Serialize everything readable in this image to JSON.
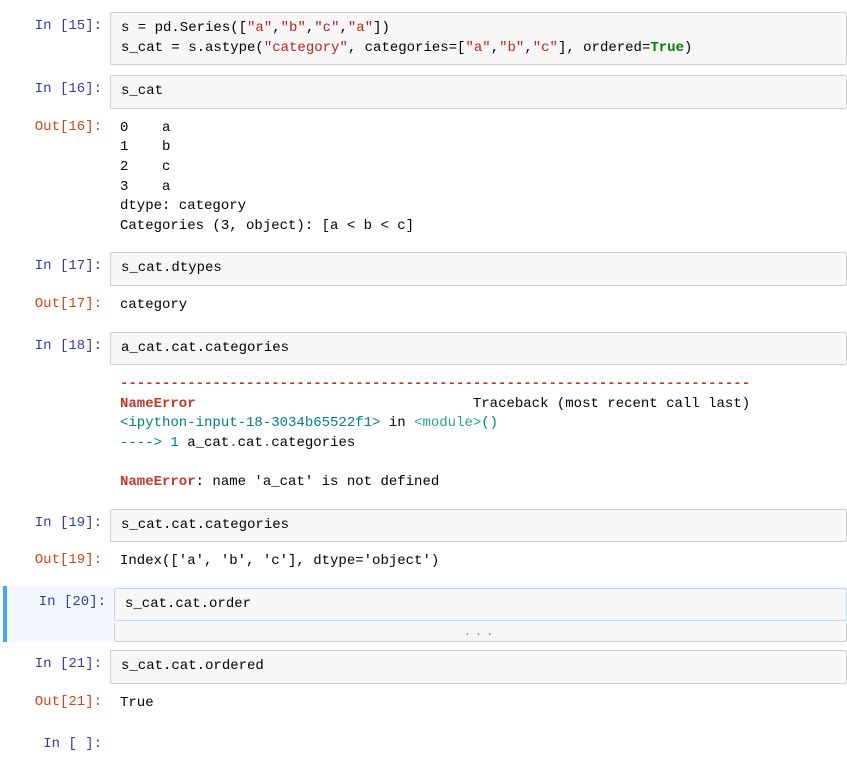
{
  "cells": {
    "c15": {
      "in_prompt": "In  [15]:",
      "code_parts": {
        "pre1": "s = pd.Series([",
        "qa": "\"a\"",
        "c": ",",
        "qb": "\"b\"",
        "qc": "\"c\"",
        "close1": "])",
        "line2pre": "s_cat = s.astype(",
        "cat": "\"category\"",
        "mid": ", categories=[",
        "a2": "\"a\"",
        "b2": "\"b\"",
        "c2": "\"c\"",
        "after": "], ordered=",
        "true": "True",
        "end": ")"
      }
    },
    "c16": {
      "in_prompt": "In  [16]:",
      "code": "s_cat",
      "out_prompt": "Out[16]:",
      "output": "0    a\n1    b\n2    c\n3    a\ndtype: category\nCategories (3, object): [a < b < c]"
    },
    "c17": {
      "in_prompt": "In  [17]:",
      "code": "s_cat.dtypes",
      "out_prompt": "Out[17]:",
      "output": "category"
    },
    "c18": {
      "in_prompt": "In  [18]:",
      "code": "a_cat.cat.categories",
      "err": {
        "dashes": "---------------------------------------------------------------------------",
        "name1": "NameError",
        "trace": "                                 Traceback (most recent call last)",
        "ipy": "<ipython-input-18-3034b65522f1>",
        "in": " in ",
        "mod": "<module>",
        "paren": "()",
        "arrow": "----> 1 ",
        "code1": "a_cat",
        "dot1": ".",
        "code2": "cat",
        "dot2": ".",
        "code3": "categories",
        "name2": "NameError",
        "msg": ": name 'a_cat' is not defined"
      }
    },
    "c19": {
      "in_prompt": "In  [19]:",
      "code": "s_cat.cat.categories",
      "out_prompt": "Out[19]:",
      "output": "Index(['a', 'b', 'c'], dtype='object')"
    },
    "c20": {
      "in_prompt": "In  [20]:",
      "code": "s_cat.cat.order",
      "ellipsis": "..."
    },
    "c21": {
      "in_prompt": "In  [21]:",
      "code": "s_cat.cat.ordered",
      "out_prompt": "Out[21]:",
      "output": "True"
    },
    "cNext": {
      "in_prompt": "In  [ ]:"
    }
  }
}
